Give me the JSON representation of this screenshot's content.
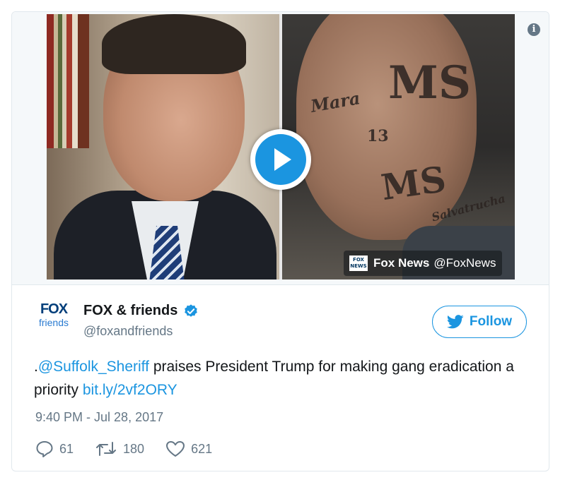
{
  "media": {
    "attribution_name": "Fox News",
    "attribution_handle": "@FoxNews",
    "mini_logo_line1": "FOX",
    "mini_logo_line2": "NEWS"
  },
  "tattoos": [
    "MS",
    "MS",
    "13",
    "Mara",
    "Salvatrucha"
  ],
  "account": {
    "logo_line1": "FOX",
    "logo_line2": "friends",
    "name": "FOX & friends",
    "handle": "@foxandfriends",
    "verified": true
  },
  "follow_label": "Follow",
  "tweet": {
    "prefix": ".",
    "mention": "@Suffolk_Sheriff",
    "text": " praises President Trump for making gang eradication a priority ",
    "link": "bit.ly/2vf2ORY",
    "timestamp": "9:40 PM - Jul 28, 2017"
  },
  "stats": {
    "replies": "61",
    "retweets": "180",
    "likes": "621"
  },
  "colors": {
    "accent": "#1b95e0",
    "secondary_text": "#657786",
    "border": "#e1e8ed"
  },
  "icons": {
    "info": "info-icon",
    "play": "play-icon",
    "verified": "verified-badge-icon",
    "follow_bird": "twitter-bird-icon",
    "reply": "reply-icon",
    "retweet": "retweet-icon",
    "like": "heart-icon"
  }
}
